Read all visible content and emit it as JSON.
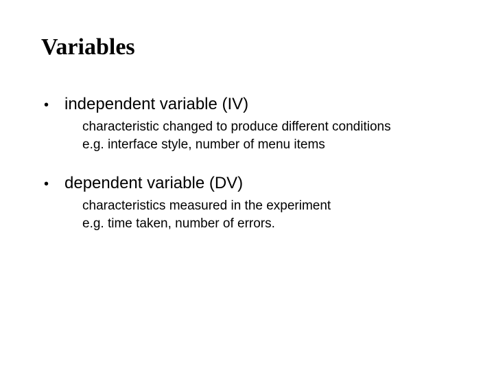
{
  "title": "Variables",
  "items": [
    {
      "label": "independent variable (IV)",
      "detail_line1": "characteristic changed to produce different conditions",
      "detail_line2": "e.g. interface style, number of menu items"
    },
    {
      "label": "dependent variable (DV)",
      "detail_line1": "characteristics measured in the experiment",
      "detail_line2": "e.g. time taken, number of errors."
    }
  ]
}
